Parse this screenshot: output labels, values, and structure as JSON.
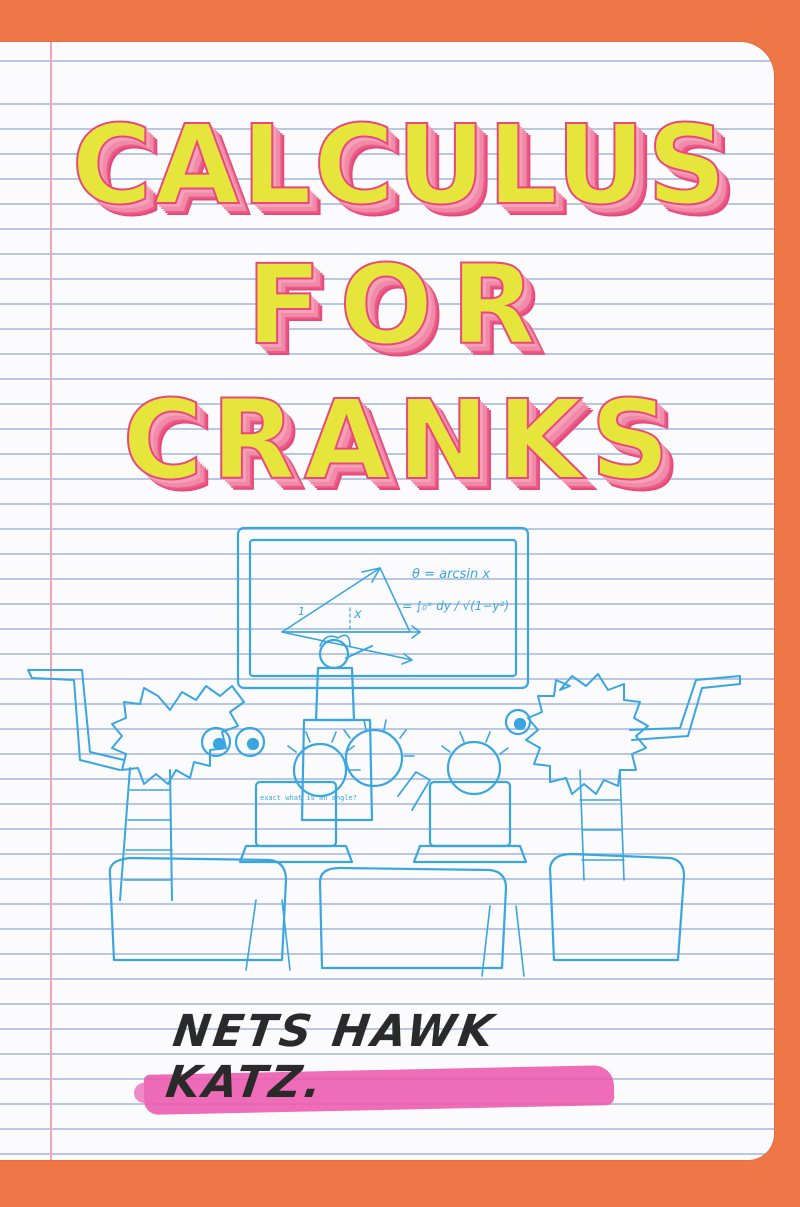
{
  "cover": {
    "title_lines": [
      "CALCULUS",
      "FOR",
      "CRANKS"
    ],
    "author": "NETS HAWK KATZ."
  },
  "illustration": {
    "screen_text": {
      "equation_1": "θ = arcsin x",
      "equation_2": "= ∫₀ˣ dy / √(1−y²)",
      "label_x": "x",
      "label_1": "1"
    },
    "laptop_text": "exact what is an angle?"
  },
  "colors": {
    "background": "#ef7747",
    "paper": "#fbfbfd",
    "rule_lines": "#b8c8e4",
    "margin_line": "#f1a6b6",
    "title_fill": "#e6e53c",
    "title_outline": "#e9497a",
    "drawing_ink": "#3aa6e0",
    "author_ink": "#2a2a2a",
    "highlighter": "#ec5cb0"
  }
}
